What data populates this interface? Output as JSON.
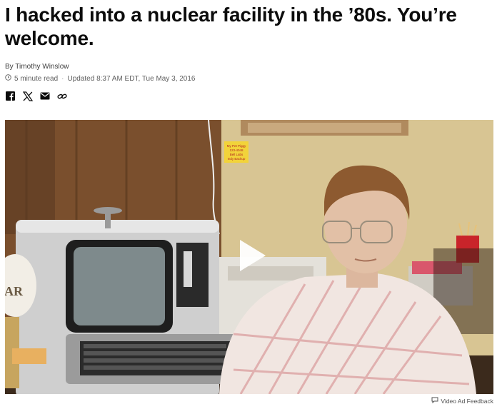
{
  "article": {
    "headline": "I hacked into a nuclear facility in the ’80s. You’re welcome.",
    "byline_prefix": "By",
    "author": "Timothy Winslow",
    "read_time": "5 minute read",
    "updated": "Updated 8:37 AM EDT, Tue May 3, 2016"
  },
  "share": {
    "icons": [
      "facebook-icon",
      "x-icon",
      "email-icon",
      "link-icon"
    ]
  },
  "media": {
    "sign_text": [
      "My Pet Piggy",
      "123-4048",
      "Bell Labs",
      "Indy Backup"
    ],
    "mug_text": "AR"
  },
  "feedback": {
    "label": "Video Ad Feedback"
  },
  "colors": {
    "text": "#0c0c0c",
    "meta": "#606060",
    "play": "#ffffff"
  }
}
